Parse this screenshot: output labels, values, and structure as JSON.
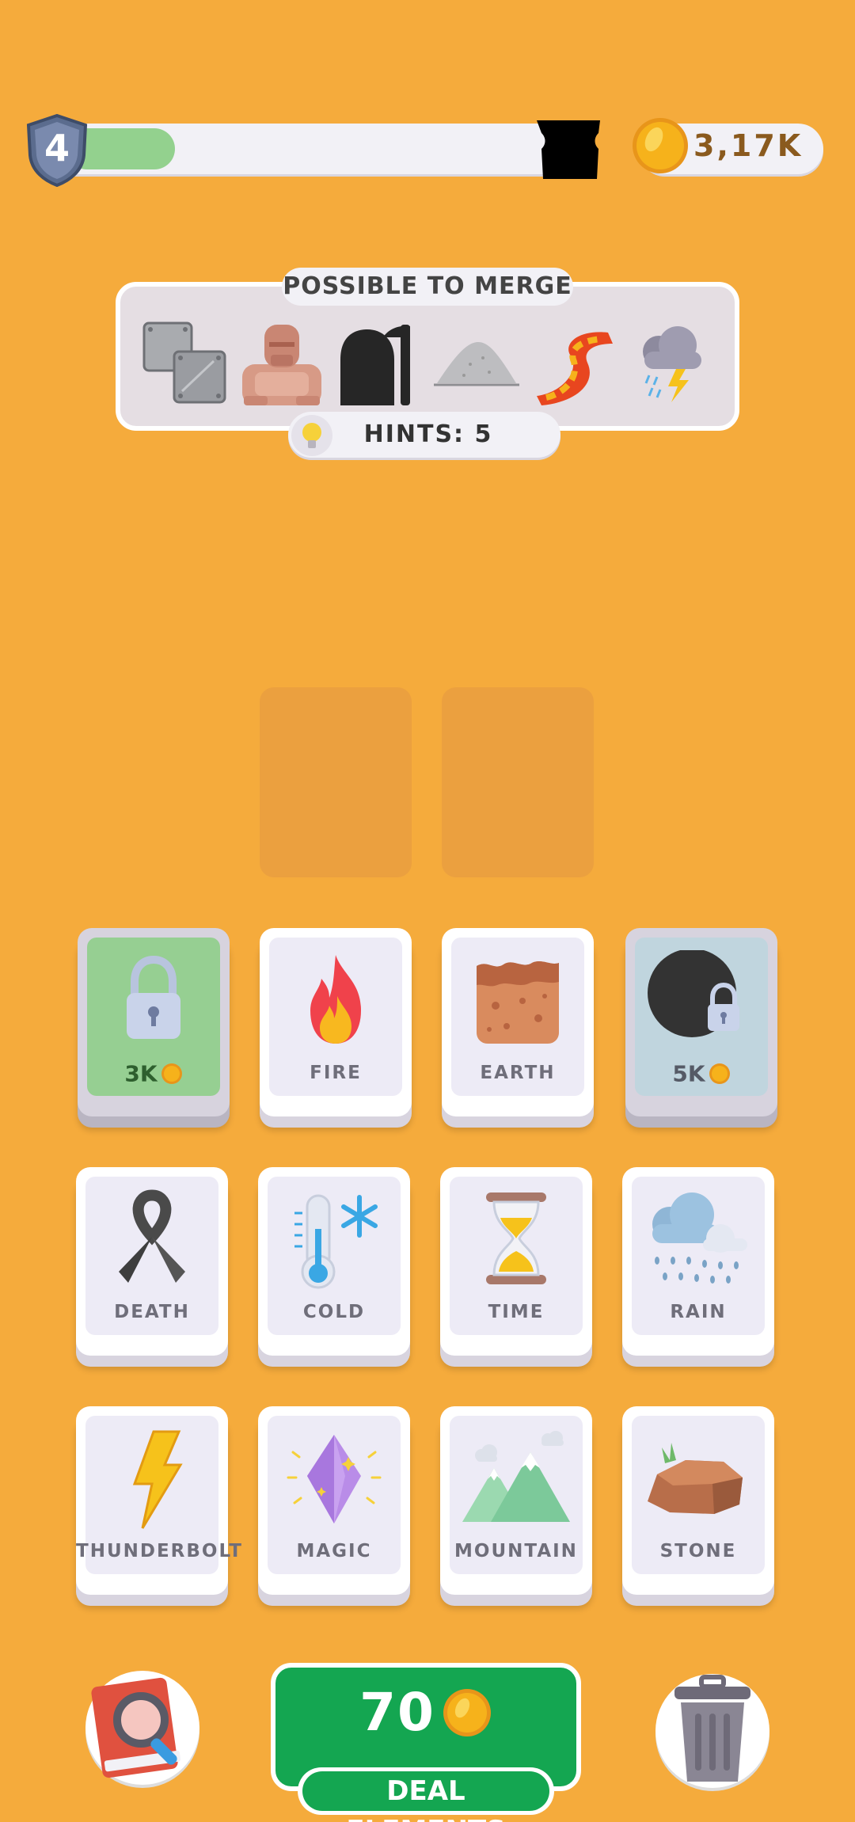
{
  "header": {
    "level": "4",
    "progress": 0.2,
    "coins": "3,17K"
  },
  "merge_panel": {
    "title": "POSSIBLE TO MERGE",
    "items": [
      "metal-icon",
      "golem-icon",
      "grim-reaper-icon",
      "sand-icon",
      "lava-icon",
      "storm-icon"
    ],
    "hints": "HINTS: 5"
  },
  "slots": 2,
  "cards": [
    {
      "id": "locked-1",
      "locked": true,
      "price": "3K",
      "icon": "lock-icon"
    },
    {
      "id": "fire",
      "label": "FIRE",
      "icon": "fire-icon"
    },
    {
      "id": "earth",
      "label": "EARTH",
      "icon": "earth-icon"
    },
    {
      "id": "locked-2",
      "locked": true,
      "price": "5K",
      "icon": "dark-orb-lock-icon"
    },
    {
      "id": "death",
      "label": "DEATH",
      "icon": "ribbon-icon"
    },
    {
      "id": "cold",
      "label": "COLD",
      "icon": "thermometer-snowflake-icon"
    },
    {
      "id": "time",
      "label": "TIME",
      "icon": "hourglass-icon"
    },
    {
      "id": "rain",
      "label": "RAIN",
      "icon": "rain-cloud-icon"
    },
    {
      "id": "thunderbolt",
      "label": "THUNDERBOLT",
      "icon": "lightning-icon"
    },
    {
      "id": "magic",
      "label": "MAGIC",
      "icon": "crystal-icon"
    },
    {
      "id": "mountain",
      "label": "MOUNTAIN",
      "icon": "mountain-icon"
    },
    {
      "id": "stone",
      "label": "STONE",
      "icon": "stone-icon"
    }
  ],
  "bottom": {
    "deal_price": "70",
    "deal_label": "DEAL ELEMENTS",
    "book_icon": "encyclopedia-icon",
    "trash_icon": "trash-can-icon"
  },
  "colors": {
    "background": "#F5AB3C",
    "deal_green": "#14A651",
    "progress_green": "#93D18E",
    "coin_gold": "#F6B21B"
  }
}
